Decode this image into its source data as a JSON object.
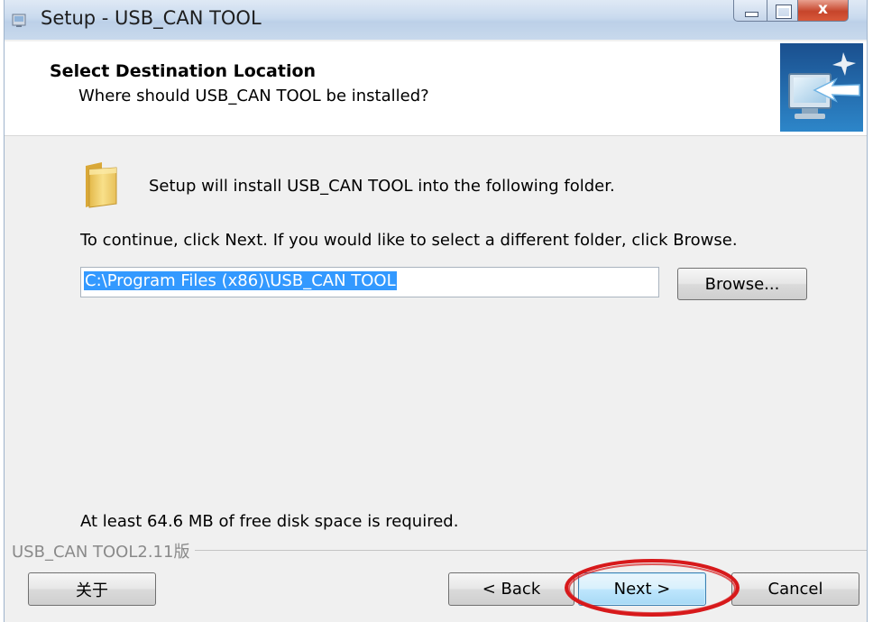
{
  "window": {
    "title": "Setup - USB_CAN TOOL",
    "close_glyph": "x"
  },
  "header": {
    "title": "Select Destination Location",
    "subtitle": "Where should USB_CAN TOOL be installed?",
    "image_icon": "monitor-arrow-icon"
  },
  "content": {
    "folder_icon": "folder-icon",
    "intro": "Setup will install USB_CAN TOOL into the following folder.",
    "instructions": "To continue, click Next. If you would like to select a different folder, click Browse.",
    "path_value": "C:\\Program Files (x86)\\USB_CAN TOOL",
    "browse_label": "Browse...",
    "space_required": "At least 64.6 MB of free disk space is required."
  },
  "footer": {
    "version_label": "USB_CAN TOOL2.11版",
    "about_label": "关于",
    "back_label": "< Back",
    "next_label": "Next >",
    "cancel_label": "Cancel"
  },
  "colors": {
    "selection": "#3399ff",
    "highlight_ring": "#d7191b",
    "next_border": "#3c7fb1"
  }
}
